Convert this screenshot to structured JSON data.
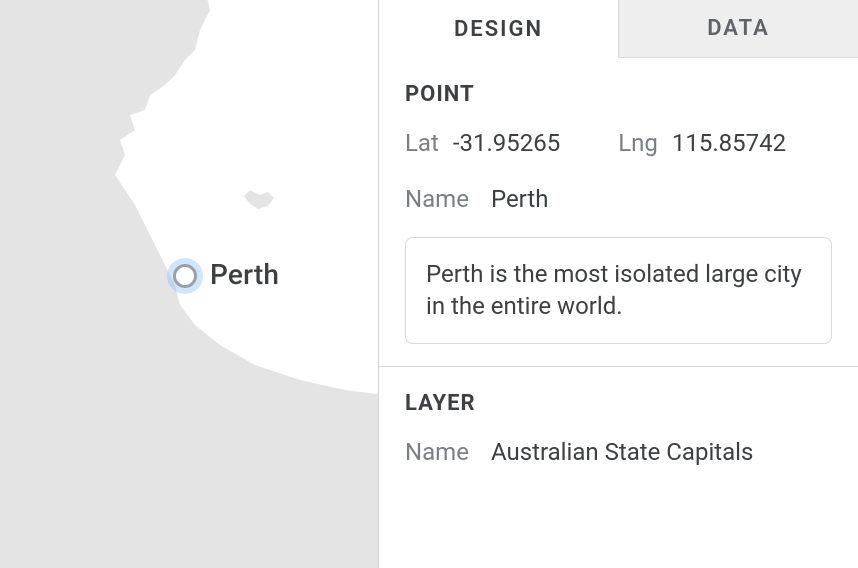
{
  "tabs": {
    "design": "DESIGN",
    "data": "DATA"
  },
  "map": {
    "point_label": "Perth"
  },
  "point_section": {
    "title": "POINT",
    "lat_label": "Lat",
    "lat_value": "-31.95265",
    "lng_label": "Lng",
    "lng_value": "115.85742",
    "name_label": "Name",
    "name_value": "Perth",
    "description": "Perth is the most isolated large city in the entire world."
  },
  "layer_section": {
    "title": "LAYER",
    "name_label": "Name",
    "name_value": "Australian State Capitals"
  }
}
